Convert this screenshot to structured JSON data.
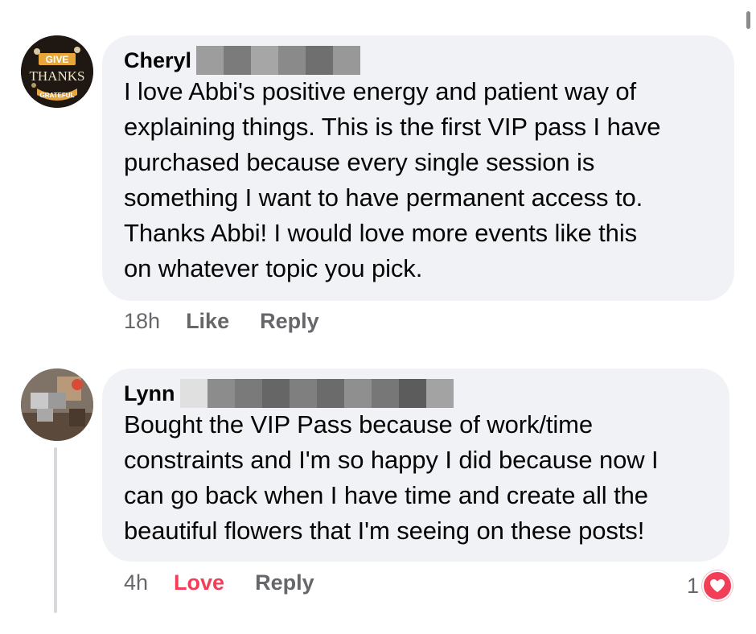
{
  "comments": [
    {
      "author": "Cheryl",
      "avatar_icon": "give-thanks-avatar-icon",
      "avatar_text": {
        "line1": "GIVE",
        "line2": "THANKS",
        "line3": "GRATEFUL"
      },
      "text": "I love Abbi's positive energy and patient way of\nexplaining things.  This is the first VIP pass I have\npurchased because every single session is\nsomething I want to have permanent access to.\nThanks Abbi!  I would love more events like this\non whatever topic you pick.",
      "time": "18h",
      "like_label": "Like",
      "reply_label": "Reply"
    },
    {
      "author": "Lynn",
      "avatar_icon": "blurred-photo-avatar-icon",
      "text": "Bought the VIP Pass because of work/time\nconstraints and I'm so happy I did because now I\ncan go back when I have time and create all the\nbeautiful flowers that I'm seeing on these posts!",
      "time": "4h",
      "like_label": "Love",
      "reply_label": "Reply",
      "reaction_count": "1",
      "reaction_icon": "heart-icon"
    }
  ],
  "colors": {
    "bubble": "#f0f2f5",
    "meta_text": "#65676b",
    "love_red": "#f33e58",
    "name_text": "#050505"
  }
}
